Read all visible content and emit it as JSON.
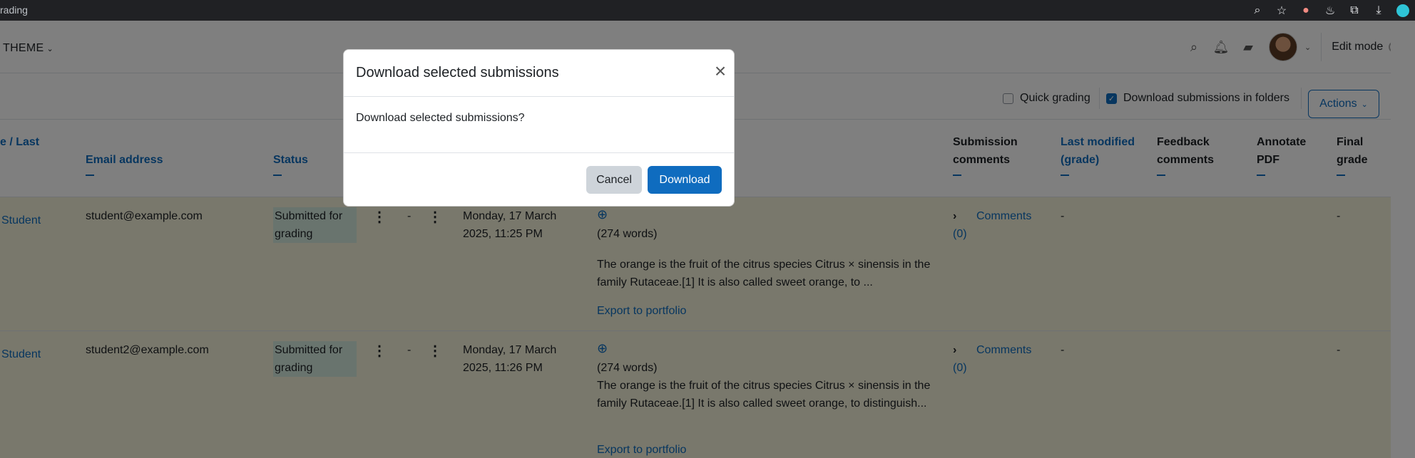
{
  "browser": {
    "tab_title": "rading"
  },
  "navbar": {
    "theme_label": "THEME",
    "edit_mode_label": "Edit mode"
  },
  "toolbar": {
    "quick_grading_label": "Quick grading",
    "download_in_folders_label": "Download submissions in folders",
    "actions_label": "Actions"
  },
  "table": {
    "headers": {
      "name": "e / Last",
      "email": "Email address",
      "status": "Status",
      "submission_comments": "Submission comments",
      "last_modified": "Last modified (grade)",
      "feedback_comments": "Feedback comments",
      "annotate_pdf": "Annotate PDF",
      "final_grade": "Final grade"
    },
    "rows": [
      {
        "name": "Student",
        "email": "student@example.com",
        "status": "Submitted for grading",
        "grade": "-",
        "modified": "Monday, 17 March 2025, 11:25 PM",
        "words": "(274 words)",
        "excerpt": "The orange is the fruit of the citrus species Citrus × sinensis in the family Rutaceae.[1] It is also called sweet orange, to ...",
        "export": "Export to portfolio",
        "comments": "Comments",
        "comments_count": "(0)",
        "last_modified_grade": "-",
        "final_grade": "-"
      },
      {
        "name": "Student",
        "email": "student2@example.com",
        "status": "Submitted for grading",
        "grade": "-",
        "modified": "Monday, 17 March 2025, 11:26 PM",
        "words": "(274 words)",
        "excerpt": "The orange is the fruit of the citrus species Citrus × sinensis in the family Rutaceae.[1] It is also called sweet orange, to distinguish...",
        "export": "Export to portfolio",
        "comments": "Comments",
        "comments_count": "(0)",
        "last_modified_grade": "-",
        "final_grade": "-"
      }
    ]
  },
  "modal": {
    "title": "Download selected submissions",
    "body": "Download selected submissions?",
    "cancel_label": "Cancel",
    "download_label": "Download"
  },
  "colors": {
    "primary": "#0f6cbf",
    "row_bg": "#f3f0d9",
    "status_bg": "#d3e9dd"
  }
}
